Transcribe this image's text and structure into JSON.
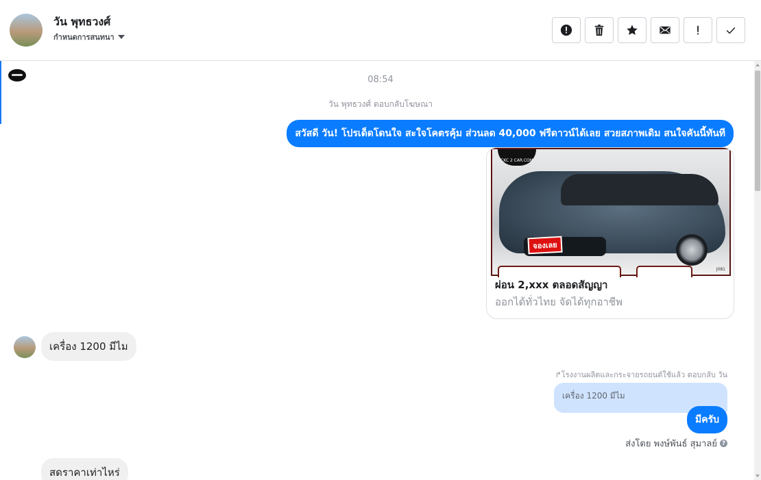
{
  "header": {
    "contact_name": "วัน พุทธวงศ์",
    "assign_label": "กำหนดการสนทนา",
    "toolbar": [
      {
        "icon": "alert-circle-icon",
        "name": "report-button"
      },
      {
        "icon": "trash-icon",
        "name": "delete-button"
      },
      {
        "icon": "star-icon",
        "name": "star-button"
      },
      {
        "icon": "envelope-icon",
        "name": "mark-unread-button"
      },
      {
        "icon": "exclamation-icon",
        "name": "mark-spam-button"
      },
      {
        "icon": "check-icon",
        "name": "mark-done-button"
      }
    ]
  },
  "conversation": {
    "timestamp": "08:54",
    "ad_reply_note": "วัน พุทธวงศ์ ตอบกลับโฆษณา",
    "outgoing_greeting": "สวัสดี วัน! โปรเด็ดโดนใจ สะใจโคตรคุ้ม ส่วนลด 40,000 ฟรีดาวน์ได้เลย สวยสภาพเดิม สนใจคันนี้ทันที",
    "ad_card": {
      "logo_text": "CKC 2 CAR.COM",
      "sticker_text": "จองเลย",
      "code_text": "J081",
      "title": "ผ่อน 2,xxx ตลอดสัญญา",
      "subtitle": "ออกได้ทั่วไทย จัดได้ทุกอาชีพ"
    },
    "incoming_1": "เครื่อง  1200  มีไม",
    "reply_context": "โรงงานผลิตและกระจายรถยนต์ใช้แล้ว ตอบกลับ วัน",
    "quoted_text": "เครื่อง 1200 มีไม",
    "outgoing_reply": "มีครับ",
    "sent_by": "ส่งโดย พงษ์พันธ์ สุมาลย์",
    "incoming_2": "สดราคาเท่าไหร่"
  },
  "colors": {
    "accent": "#0a7cff",
    "incoming_bg": "#f1f0f0",
    "quote_bg": "#cfe3ff"
  }
}
